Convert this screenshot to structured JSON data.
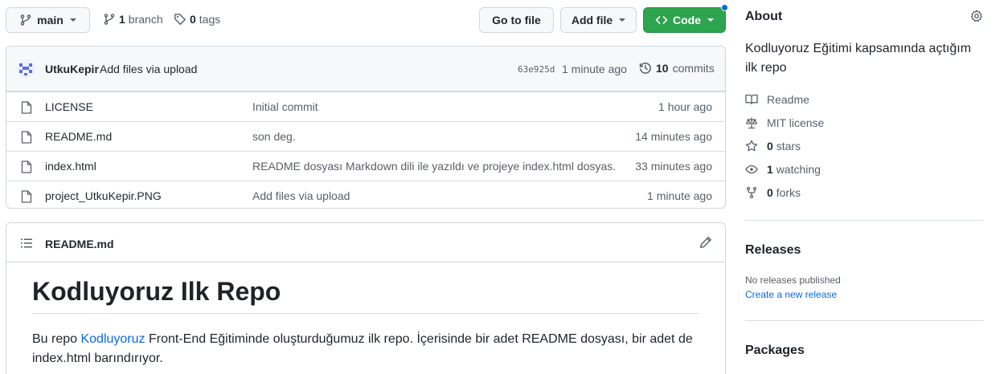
{
  "toolbar": {
    "branch": "main",
    "branch_count": "1",
    "branch_label": "branch",
    "tag_count": "0",
    "tag_label": "tags",
    "go_to_file": "Go to file",
    "add_file": "Add file",
    "code": "Code"
  },
  "commit": {
    "author": "UtkuKepir",
    "message": "Add files via upload",
    "sha": "63e925d",
    "time": "1 minute ago",
    "count": "10",
    "count_label": "commits"
  },
  "files": [
    {
      "name": "LICENSE",
      "commit": "Initial commit",
      "time": "1 hour ago"
    },
    {
      "name": "README.md",
      "commit": "son deg.",
      "time": "14 minutes ago"
    },
    {
      "name": "index.html",
      "commit": "README dosyası Markdown dili ile yazıldı ve projeye index.html dosyas...",
      "time": "33 minutes ago"
    },
    {
      "name": "project_UtkuKepir.PNG",
      "commit": "Add files via upload",
      "time": "1 minute ago"
    }
  ],
  "readme": {
    "filename": "README.md",
    "heading": "Kodluyoruz Ilk Repo",
    "para_before": "Bu repo ",
    "para_link": "Kodluyoruz",
    "para_after": " Front-End Eğitiminde oluşturduğumuz ilk repo. İçerisinde bir adet README dosyası, bir adet de index.html barındırıyor."
  },
  "about": {
    "title": "About",
    "description": "Kodluyoruz Eğitimi kapsamında açtığım ilk repo",
    "readme": "Readme",
    "license": "MIT license",
    "stars_count": "0",
    "stars_label": "stars",
    "watching_count": "1",
    "watching_label": "watching",
    "forks_count": "0",
    "forks_label": "forks"
  },
  "releases": {
    "title": "Releases",
    "none_text": "No releases published",
    "create_link": "Create a new release"
  },
  "packages": {
    "title": "Packages"
  },
  "colors": {
    "accent": "#0969da",
    "code_button": "#2da44e",
    "border": "#d0d7de"
  }
}
